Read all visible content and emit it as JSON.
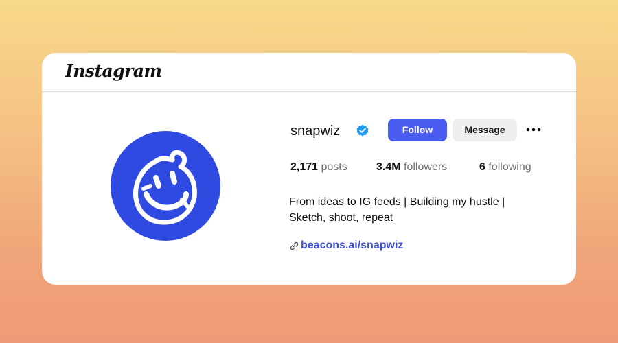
{
  "header": {
    "logo_text": "Instagram"
  },
  "profile": {
    "username": "snapwiz",
    "verified": true,
    "follow_label": "Follow",
    "message_label": "Message",
    "more_icon": "more-options-icon",
    "stats": {
      "posts_count": "2,171",
      "posts_label": "posts",
      "followers_count": "3.4M",
      "followers_label": "followers",
      "following_count": "6",
      "following_label": "following"
    },
    "bio_line1": "From ideas to IG feeds | Building my hustle |",
    "bio_line2": "Sketch, shoot, repeat",
    "link_text": "beacons.ai/snapwiz"
  },
  "colors": {
    "accent": "#4a5cf0",
    "avatar_bg": "#2f4ae0",
    "verified_badge": "#1d9bf0",
    "link": "#3d52d5"
  }
}
